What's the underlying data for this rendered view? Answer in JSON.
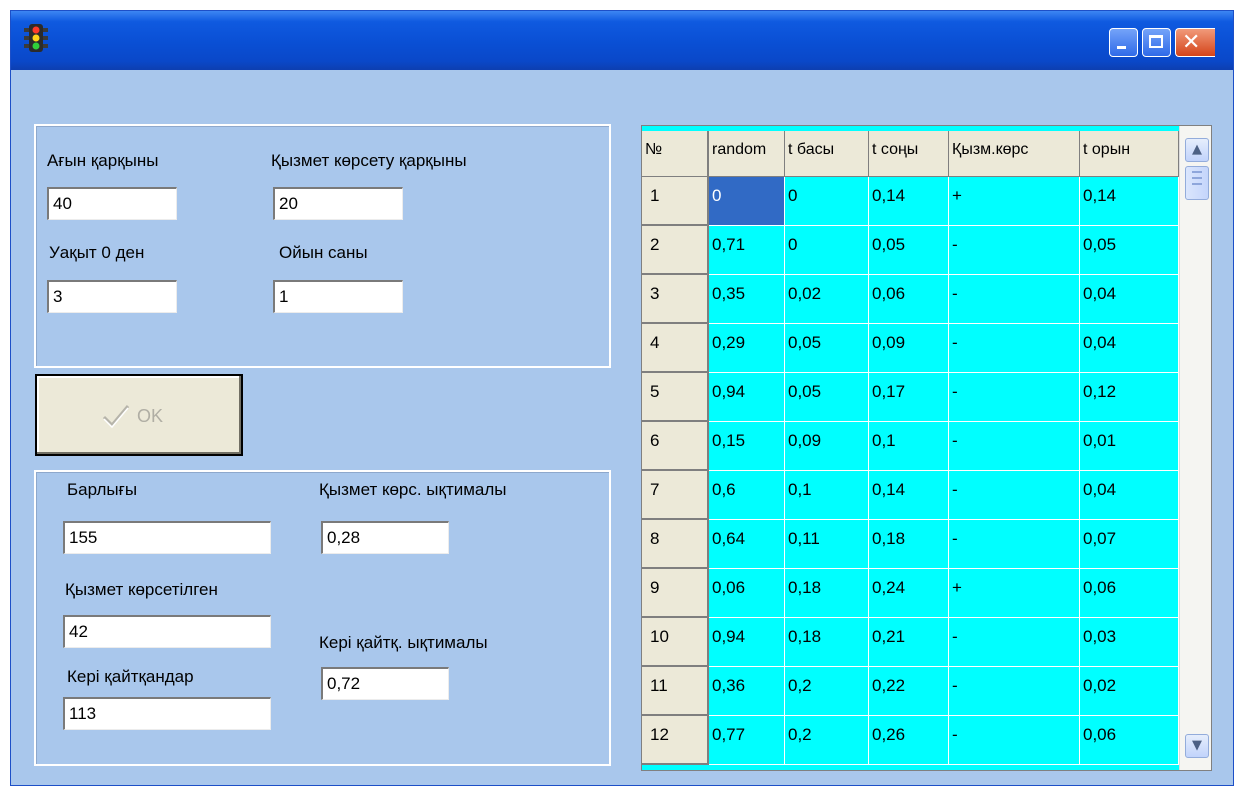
{
  "window": {
    "title": ""
  },
  "inputs": {
    "flow_rate": {
      "label": "Ағын қарқыны",
      "value": "40"
    },
    "service_rate": {
      "label": "Қызмет көрсету қарқыны",
      "value": "20"
    },
    "time_from": {
      "label": "Уақыт 0 ден",
      "value": "3"
    },
    "game_count": {
      "label": "Ойын саны",
      "value": "1"
    }
  },
  "ok_button": {
    "label": "OK"
  },
  "results": {
    "total": {
      "label": "Барлығы",
      "value": "155"
    },
    "service_prob": {
      "label": "Қызмет көрс. ықтималы",
      "value": "0,28"
    },
    "served": {
      "label": "Қызмет көрсетілген",
      "value": "42"
    },
    "return_prob": {
      "label": "Кері қайтқ. ықтималы",
      "value": "0,72"
    },
    "returned": {
      "label": "Кері қайтқандар",
      "value": "113"
    }
  },
  "table": {
    "headers": [
      "№",
      "random",
      "t басы",
      "t соңы",
      "Қызм.көрс",
      "t орын"
    ],
    "rows": [
      [
        "1",
        "0",
        "0",
        "0,14",
        "+",
        "0,14"
      ],
      [
        "2",
        "0,71",
        "0",
        "0,05",
        "-",
        "0,05"
      ],
      [
        "3",
        "0,35",
        "0,02",
        "0,06",
        "-",
        "0,04"
      ],
      [
        "4",
        "0,29",
        "0,05",
        "0,09",
        "-",
        "0,04"
      ],
      [
        "5",
        "0,94",
        "0,05",
        "0,17",
        "-",
        "0,12"
      ],
      [
        "6",
        "0,15",
        "0,09",
        "0,1",
        "-",
        "0,01"
      ],
      [
        "7",
        "0,6",
        "0,1",
        "0,14",
        "-",
        "0,04"
      ],
      [
        "8",
        "0,64",
        "0,11",
        "0,18",
        "-",
        "0,07"
      ],
      [
        "9",
        "0,06",
        "0,18",
        "0,24",
        "+",
        "0,06"
      ],
      [
        "10",
        "0,94",
        "0,18",
        "0,21",
        "-",
        "0,03"
      ],
      [
        "11",
        "0,36",
        "0,2",
        "0,22",
        "-",
        "0,02"
      ],
      [
        "12",
        "0,77",
        "0,2",
        "0,26",
        "-",
        "0,06"
      ]
    ]
  },
  "icons": {
    "app": "traffic-light-icon",
    "minimize": "minimize-icon",
    "maximize": "maximize-icon",
    "close": "close-icon",
    "ok": "checkmark-icon",
    "scroll_up": "chevron-up-icon",
    "scroll_down": "chevron-down-icon"
  },
  "colors": {
    "titlebar": "#0a4fd4",
    "window_bg": "#a9c7ec",
    "grid_cells": "#00ffff",
    "selected_cell": "#316ac5"
  }
}
